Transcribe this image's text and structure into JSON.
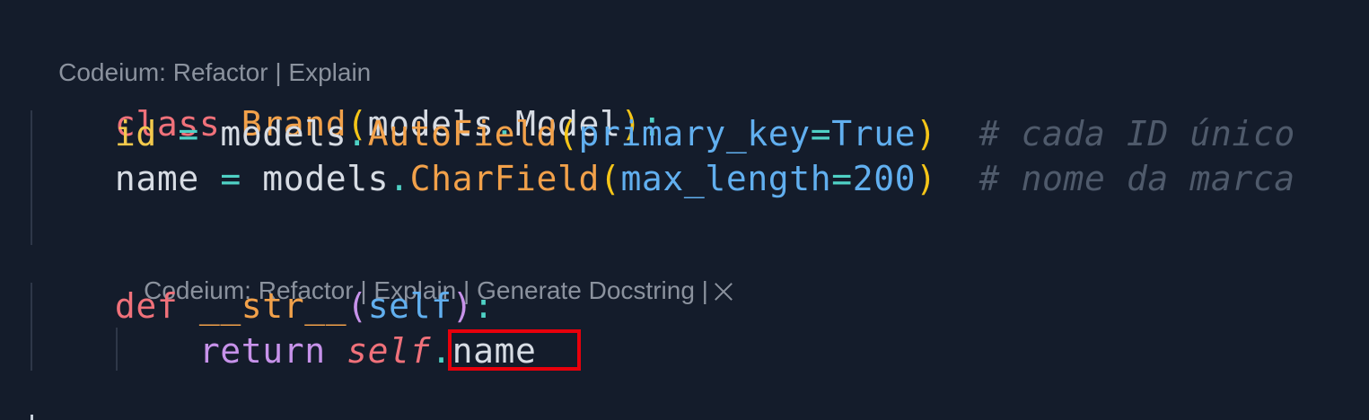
{
  "lens_top": {
    "prefix": "Codeium: ",
    "refactor": "Refactor",
    "sep1": " | ",
    "explain": "Explain"
  },
  "lens_method": {
    "prefix": "Codeium: ",
    "refactor": "Refactor",
    "sep1": " | ",
    "explain": "Explain",
    "sep2": " | ",
    "docstring": "Generate Docstring",
    "sep3": " |"
  },
  "code": {
    "line1": {
      "kw": "class",
      "name": "Brand",
      "open": "(",
      "mod": "models",
      "dot": ".",
      "base": "Model",
      "close": ")",
      "colon": ":"
    },
    "line2": {
      "var": "id",
      "eq": "=",
      "mod": "models",
      "dot": ".",
      "fn": "AutoField",
      "open": "(",
      "param": "primary_key",
      "eq2": "=",
      "val": "True",
      "close": ")",
      "comment": "# cada ID único"
    },
    "line3": {
      "var": "name",
      "eq": "=",
      "mod": "models",
      "dot": ".",
      "fn": "CharField",
      "open": "(",
      "param": "max_length",
      "eq2": "=",
      "val": "200",
      "close": ")",
      "comment": "# nome da marca"
    },
    "line4": {
      "kw": "def",
      "fn": "__str__",
      "open": "(",
      "param": "self",
      "close": ")",
      "colon": ":"
    },
    "line5": {
      "kw": "return",
      "self": "self",
      "dot": ".",
      "attr": "name"
    }
  },
  "colors": {
    "background": "#141c2b",
    "highlight": "#e8000b"
  }
}
